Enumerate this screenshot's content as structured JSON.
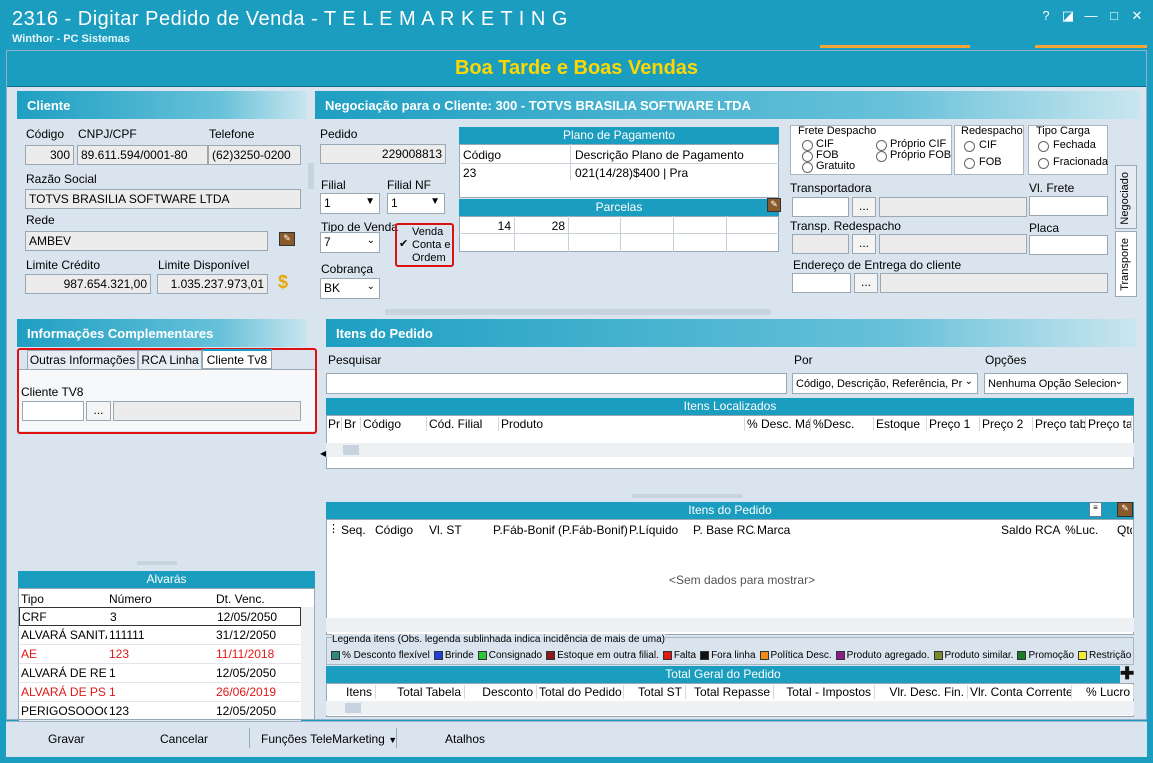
{
  "window": {
    "title": "2316 - Digitar Pedido de Venda - T E L E M A R K E T I N G",
    "subtitle": "Winthor - PC Sistemas",
    "controls": [
      "?",
      "◪",
      "—",
      "□",
      "✕"
    ]
  },
  "banner": "Boa Tarde e Boas Vendas",
  "cliente": {
    "header": "Cliente",
    "codigo_label": "Código",
    "codigo": "300",
    "cnpj_label": "CNPJ/CPF",
    "cnpj": "89.611.594/0001-80",
    "telefone_label": "Telefone",
    "telefone": "(62)3250-0200",
    "razao_label": "Razão Social",
    "razao": "TOTVS BRASILIA SOFTWARE LTDA",
    "rede_label": "Rede",
    "rede": "AMBEV",
    "limite_credito_label": "Limite Crédito",
    "limite_credito": "987.654.321,00",
    "limite_disp_label": "Limite Disponível",
    "limite_disp": "1.035.237.973,01"
  },
  "negociacao": {
    "header": "Negociação para o Cliente: 300 - TOTVS BRASILIA SOFTWARE LTDA",
    "pedido_label": "Pedido",
    "pedido": "229008813",
    "filial_label": "Filial",
    "filial": "1",
    "filial_nf_label": "Filial NF",
    "filial_nf": "1",
    "tipo_venda_label": "Tipo de Venda",
    "tipo_venda": "7",
    "cobranca_label": "Cobrança",
    "cobranca": "BK",
    "venda_conta_ordem": "Venda Conta e Ordem",
    "plano_header": "Plano de Pagamento",
    "plano_col_codigo": "Código",
    "plano_col_desc": "Descrição Plano de Pagamento",
    "plano_codigo": "23",
    "plano_desc": "021(14/28)$400 | Pra",
    "parcelas_header": "Parcelas",
    "parcelas": [
      "14",
      "28"
    ],
    "frete_label": "Frete Despacho",
    "frete_options": [
      "CIF",
      "FOB",
      "Gratuito",
      "Próprio CIF",
      "Próprio FOB"
    ],
    "redespacho_label": "Redespacho",
    "redespacho_options": [
      "CIF",
      "FOB"
    ],
    "tipo_carga_label": "Tipo Carga",
    "tipo_carga_options": [
      "Fechada",
      "Fracionada"
    ],
    "transportadora_label": "Transportadora",
    "vl_frete_label": "Vl. Frete",
    "transp_redespacho_label": "Transp. Redespacho",
    "placa_label": "Placa",
    "endereco_label": "Endereço de Entrega do cliente",
    "tab_negociado": "Negociado",
    "tab_transporte": "Transporte"
  },
  "info_comp": {
    "header": "Informações Complementares",
    "tabs": [
      "Outras Informações",
      "RCA Linha",
      "Cliente Tv8"
    ],
    "cliente_tv8_label": "Cliente TV8"
  },
  "alvaras": {
    "header": "Alvarás",
    "columns": [
      "Tipo",
      "Número",
      "Dt. Venc."
    ],
    "rows": [
      {
        "tipo": "CRF",
        "numero": "3",
        "venc": "12/05/2050",
        "red": false
      },
      {
        "tipo": "ALVARÁ SANITÁR",
        "numero": "111111",
        "venc": "31/12/2050",
        "red": false
      },
      {
        "tipo": "AE",
        "numero": "123",
        "venc": "11/11/2018",
        "red": true
      },
      {
        "tipo": "ALVARÁ DE RETIF",
        "numero": "1",
        "venc": "12/05/2050",
        "red": false
      },
      {
        "tipo": "ALVARÁ DE PSICO",
        "numero": "1",
        "venc": "26/06/2019",
        "red": true
      },
      {
        "tipo": "PERIGOSOOOOO",
        "numero": "123",
        "venc": "12/05/2050",
        "red": false
      }
    ]
  },
  "itens": {
    "header": "Itens do Pedido",
    "pesquisar_label": "Pesquisar",
    "por_label": "Por",
    "por_value": "Código, Descrição, Referência, Pr",
    "opcoes_label": "Opções",
    "opcoes_value": "Nenhuma Opção Selecion",
    "localizados_header": "Itens Localizados",
    "localizados_cols": [
      "Pr",
      "Br",
      "Código",
      "Cód. Filial",
      "Produto",
      "% Desc. Máx",
      "%Desc.",
      "Estoque",
      "Preço 1",
      "Preço 2",
      "Preço tabe",
      "Preço tab"
    ],
    "pedido_header": "Itens do Pedido",
    "pedido_cols": [
      "Seq.",
      "Código",
      "Vl. ST",
      "P.Fáb-Bonif.",
      "(P.Fáb-Bonif)",
      "P.Líquido",
      "P. Base RCA",
      "Marca",
      "Saldo RCA",
      "%Luc.",
      "Qtd"
    ],
    "empty": "<Sem dados para mostrar>",
    "legenda_title": "Legenda itens (Obs. legenda sublinhada indica incidência de mais de uma)",
    "legenda": [
      {
        "label": "% Desconto flexível",
        "color": "#2e8b7a"
      },
      {
        "label": "Brinde",
        "color": "#1f3fd6"
      },
      {
        "label": "Consignado",
        "color": "#2ec43a"
      },
      {
        "label": "Estoque em outra filial.",
        "color": "#8b1a1a"
      },
      {
        "label": "Falta",
        "color": "#e01818"
      },
      {
        "label": "Fora linha",
        "color": "#111111"
      },
      {
        "label": "Política Desc.",
        "color": "#f08a18"
      },
      {
        "label": "Produto agregado.",
        "color": "#8a1f8a"
      },
      {
        "label": "Produto similar.",
        "color": "#7a8a2e"
      },
      {
        "label": "Promoção",
        "color": "#1f7a2e"
      },
      {
        "label": "Restrição",
        "color": "#f2e93a"
      }
    ],
    "total_header": "Total Geral do Pedido",
    "total_cols": [
      "Itens",
      "Total Tabela",
      "Desconto",
      "Total do Pedido",
      "Total ST",
      "Total Repasse",
      "Total - Impostos",
      "Vlr. Desc. Fin.",
      "Vlr. Conta Corrente",
      "% Lucro"
    ]
  },
  "footer": {
    "gravar": "Gravar",
    "cancelar": "Cancelar",
    "funcoes": "Funções TeleMarketing",
    "atalhos": "Atalhos"
  }
}
